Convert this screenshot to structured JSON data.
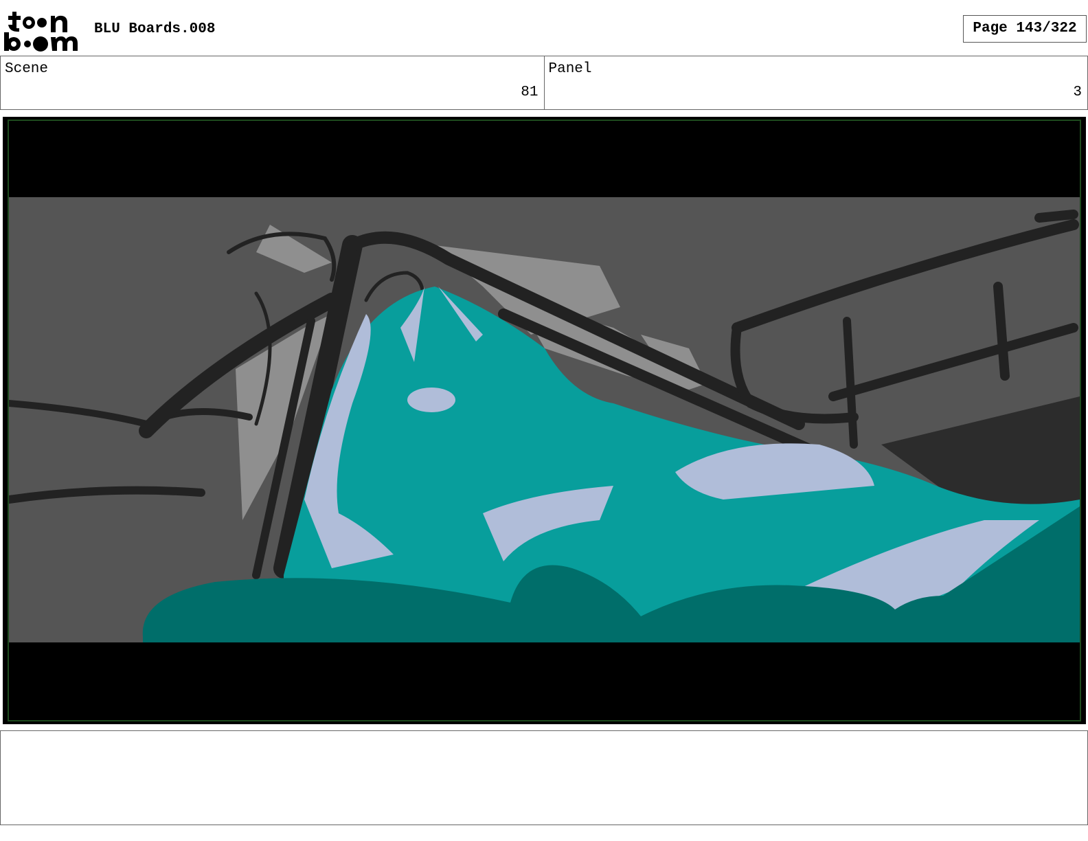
{
  "header": {
    "logo_text_line1": "toon",
    "logo_text_line2": "boom",
    "document_title": "BLU Boards.008",
    "page_indicator": "Page 143/322"
  },
  "info": {
    "scene_label": "Scene",
    "scene_value": "81",
    "panel_label": "Panel",
    "panel_value": "3"
  },
  "notes": {
    "text": ""
  },
  "colors": {
    "background_gray": "#555555",
    "light_gray": "#8f8f8f",
    "line_dark": "#222222",
    "teal": "#089e9c",
    "dark_teal": "#006e6a",
    "highlight_lavender": "#b0bdd9",
    "frame_green": "#1d4a1d"
  }
}
